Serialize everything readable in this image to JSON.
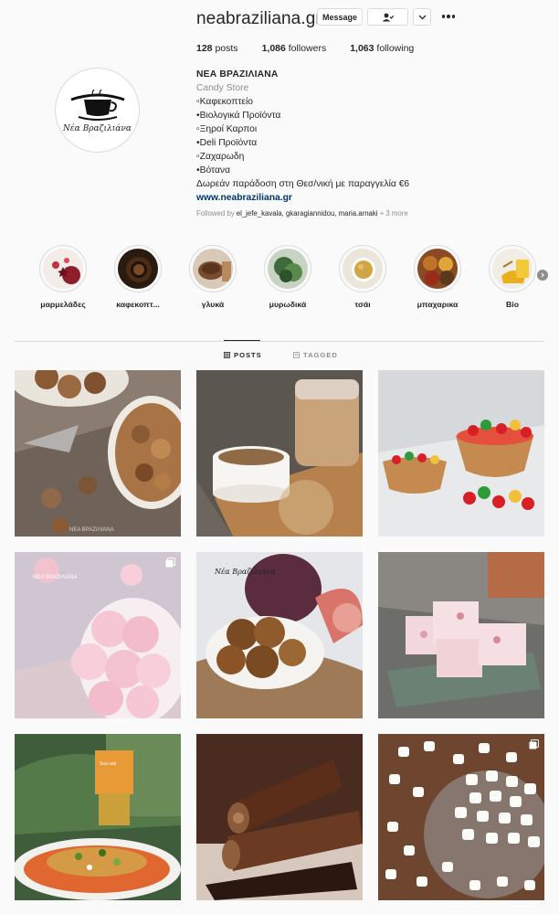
{
  "profile": {
    "username": "neabraziliana.gr",
    "buttons": {
      "message": "Message"
    },
    "stats": {
      "posts": "128",
      "posts_label": "posts",
      "followers": "1,086",
      "followers_label": "followers",
      "following": "1,063",
      "following_label": "following"
    },
    "avatar_text": "Νέα Βραζιλιάνα",
    "bio": {
      "name": "ΝΕΑ ΒΡΑΖΙΛΙΑΝΑ",
      "category": "Candy Store",
      "lines": [
        "▫Καφεκοπτείο",
        "•Βιολογικά Προϊόντα",
        "▫Ξηροί Καρποι",
        "•Deli Προϊόντα",
        "▫Ζαχαρωδη",
        "•Βότανα",
        "Δωρεάν παράδοση στη Θεσ/νική με παραγγελία €6"
      ],
      "link": "www.neabraziliana.gr"
    },
    "followed_by": {
      "prefix": "Followed by",
      "users": "el_jefe_kavala, gkaragiannidou, maria.arnaki",
      "more": "+ 3 more"
    }
  },
  "highlights": [
    {
      "label": "μαρμελάδες"
    },
    {
      "label": "καφεκοπτ..."
    },
    {
      "label": "γλυκά"
    },
    {
      "label": "μυρωδικά"
    },
    {
      "label": "τσάι"
    },
    {
      "label": "μπαχαρικα"
    },
    {
      "label": "Bio"
    }
  ],
  "tabs": {
    "posts": "POSTS",
    "tagged": "TAGGED"
  },
  "posts": [
    {
      "subject": "walnuts"
    },
    {
      "subject": "tahini jars"
    },
    {
      "subject": "candies in bowls"
    },
    {
      "subject": "meringues"
    },
    {
      "subject": "dried figs"
    },
    {
      "subject": "turkish delight"
    },
    {
      "subject": "fish dish with drink"
    },
    {
      "subject": "chocolate bars"
    },
    {
      "subject": "marshmallows"
    }
  ],
  "colors": {
    "link": "#00376b",
    "secondary": "#8e8e8e",
    "border": "#dbdbdb",
    "text": "#262626"
  }
}
